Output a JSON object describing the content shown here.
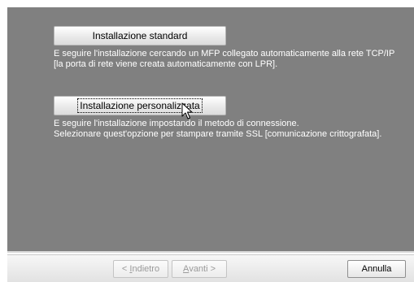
{
  "options": {
    "standard": {
      "label": "Installazione standard",
      "description_line1": "E seguire l'installazione cercando un MFP collegato automaticamente alla rete TCP/IP",
      "description_line2": "[la porta di rete viene creata automaticamente con LPR]."
    },
    "custom": {
      "label": "Installazione personalizzata",
      "description_line1": "E seguire l'installazione impostando il metodo di connessione.",
      "description_line2": "Selezionare quest'opzione per stampare tramite SSL [comunicazione crittografata]."
    }
  },
  "footer": {
    "back_prefix": "< ",
    "back_accel": "I",
    "back_rest": "ndietro",
    "next_accel": "A",
    "next_rest": "vanti >",
    "cancel": "Annulla"
  },
  "colors": {
    "panel_background": "#808080",
    "description_text": "#ffffff",
    "disabled_text": "#9a9a9a"
  },
  "icons": {
    "pointer": "mouse-pointer-icon"
  }
}
